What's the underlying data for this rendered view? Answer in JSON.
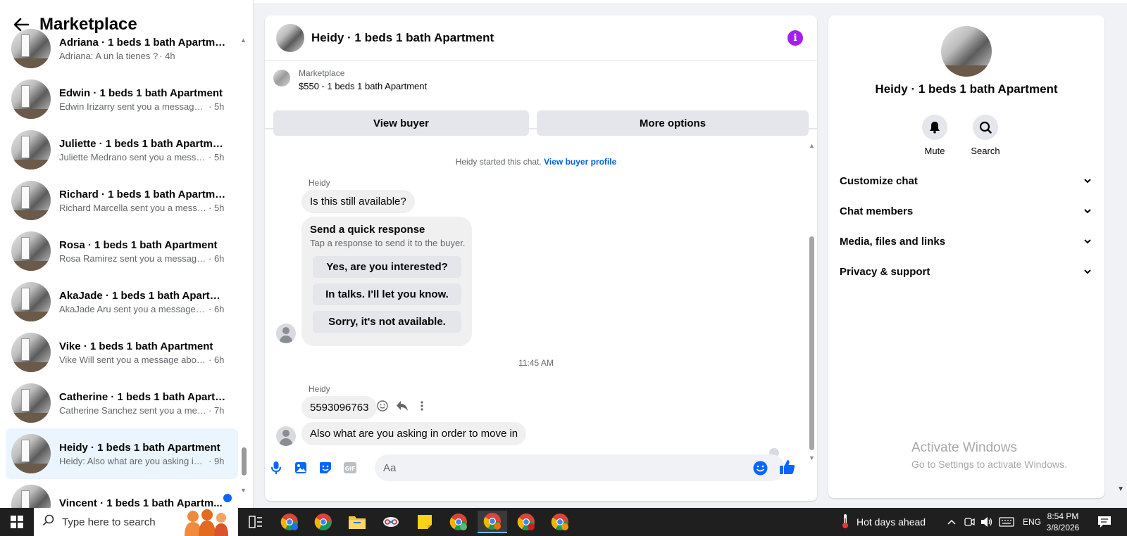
{
  "sidebar": {
    "title": "Marketplace",
    "conversations": [
      {
        "name": "Adriana · 1 beds 1 bath Apartment",
        "snippet": "Adriana: A un la tienes ?",
        "time": "· 4h"
      },
      {
        "name": "Edwin · 1 beds 1 bath Apartment",
        "snippet": "Edwin Irizarry sent you a message a...",
        "time": "· 5h"
      },
      {
        "name": "Juliette · 1 beds 1 bath Apartment",
        "snippet": "Juliette Medrano sent you a messa...",
        "time": "· 5h"
      },
      {
        "name": "Richard · 1 beds 1 bath Apartment",
        "snippet": "Richard Marcella sent you a messa...",
        "time": "· 5h"
      },
      {
        "name": "Rosa · 1 beds 1 bath Apartment",
        "snippet": "Rosa Ramirez sent you a message a...",
        "time": "· 6h"
      },
      {
        "name": "AkaJade · 1 beds 1 bath Apartme...",
        "snippet": "AkaJade Aru sent you a message a...",
        "time": "· 6h"
      },
      {
        "name": "Vike · 1 beds 1 bath Apartment",
        "snippet": "Vike Will sent you a message about...",
        "time": "· 6h"
      },
      {
        "name": "Catherine · 1 beds 1 bath Apartm...",
        "snippet": "Catherine Sanchez sent you a mess...",
        "time": "· 7h"
      },
      {
        "name": "Heidy · 1 beds 1 bath Apartment",
        "snippet": "Heidy: Also what are you asking in ...",
        "time": "· 9h"
      },
      {
        "name": "Vincent · 1 beds 1 bath Apartm...",
        "snippet": "",
        "time": ""
      }
    ]
  },
  "chat": {
    "title": "Heidy · 1 beds 1 bath Apartment",
    "marketplace_label": "Marketplace",
    "listing": "$550 - 1 beds 1 bath Apartment",
    "view_buyer": "View buyer",
    "more_options": "More options",
    "started_text": "Heidy started this chat.",
    "view_profile": "View buyer profile",
    "sender_1": "Heidy",
    "msg_1": "Is this still available?",
    "quick_title": "Send a quick response",
    "quick_sub": "Tap a response to send it to the buyer.",
    "quick_1": "Yes, are you interested?",
    "quick_2": "In talks. I'll let you know.",
    "quick_3": "Sorry, it's not available.",
    "timestamp": "11:45 AM",
    "sender_2": "Heidy",
    "msg_2": "5593096763",
    "msg_3": "Also what are you asking in order to move in",
    "input_placeholder": "Aa",
    "gif_label": "GIF"
  },
  "details": {
    "name": "Heidy · 1 beds 1 bath Apartment",
    "mute": "Mute",
    "search": "Search",
    "rows": [
      "Customize chat",
      "Chat members",
      "Media, files and links",
      "Privacy & support"
    ]
  },
  "watermark": {
    "line1": "Activate Windows",
    "line2": "Go to Settings to activate Windows."
  },
  "taskbar": {
    "search_placeholder": "Type here to search",
    "weather": "Hot days ahead",
    "lang": "ENG",
    "time": "8:54 PM",
    "date": "3/8/2026"
  }
}
